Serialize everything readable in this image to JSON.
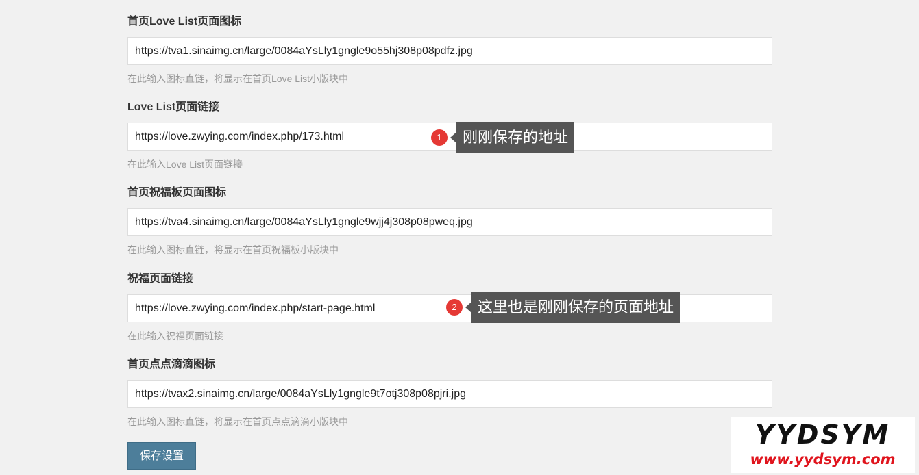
{
  "fields": [
    {
      "label": "首页Love List页面图标",
      "value": "https://tva1.sinaimg.cn/large/0084aYsLly1gngle9o55hj308p08pdfz.jpg",
      "help": "在此输入图标直链，将显示在首页Love List小版块中"
    },
    {
      "label": "Love List页面链接",
      "value": "https://love.zwying.com/index.php/173.html",
      "help": "在此输入Love List页面链接"
    },
    {
      "label": "首页祝福板页面图标",
      "value": "https://tva4.sinaimg.cn/large/0084aYsLly1gngle9wjj4j308p08pweq.jpg",
      "help": "在此输入图标直链，将显示在首页祝福板小版块中"
    },
    {
      "label": "祝福页面链接",
      "value": "https://love.zwying.com/index.php/start-page.html",
      "help": "在此输入祝福页面链接"
    },
    {
      "label": "首页点点滴滴图标",
      "value": "https://tvax2.sinaimg.cn/large/0084aYsLly1gngle9t7otj308p08pjri.jpg",
      "help": "在此输入图标直链，将显示在首页点点滴滴小版块中"
    }
  ],
  "callouts": [
    {
      "number": "1",
      "text": "刚刚保存的地址"
    },
    {
      "number": "2",
      "text": "这里也是刚刚保存的页面地址"
    }
  ],
  "save_button": {
    "label": "保存设置"
  },
  "watermark": {
    "logo": "YYDSYM",
    "url": "www.yydsym.com"
  },
  "colors": {
    "background": "#f1f1f1",
    "button": "#4d7e9a",
    "callout_badge": "#e53935",
    "callout_box": "#555555",
    "watermark_url": "#e0141d"
  }
}
